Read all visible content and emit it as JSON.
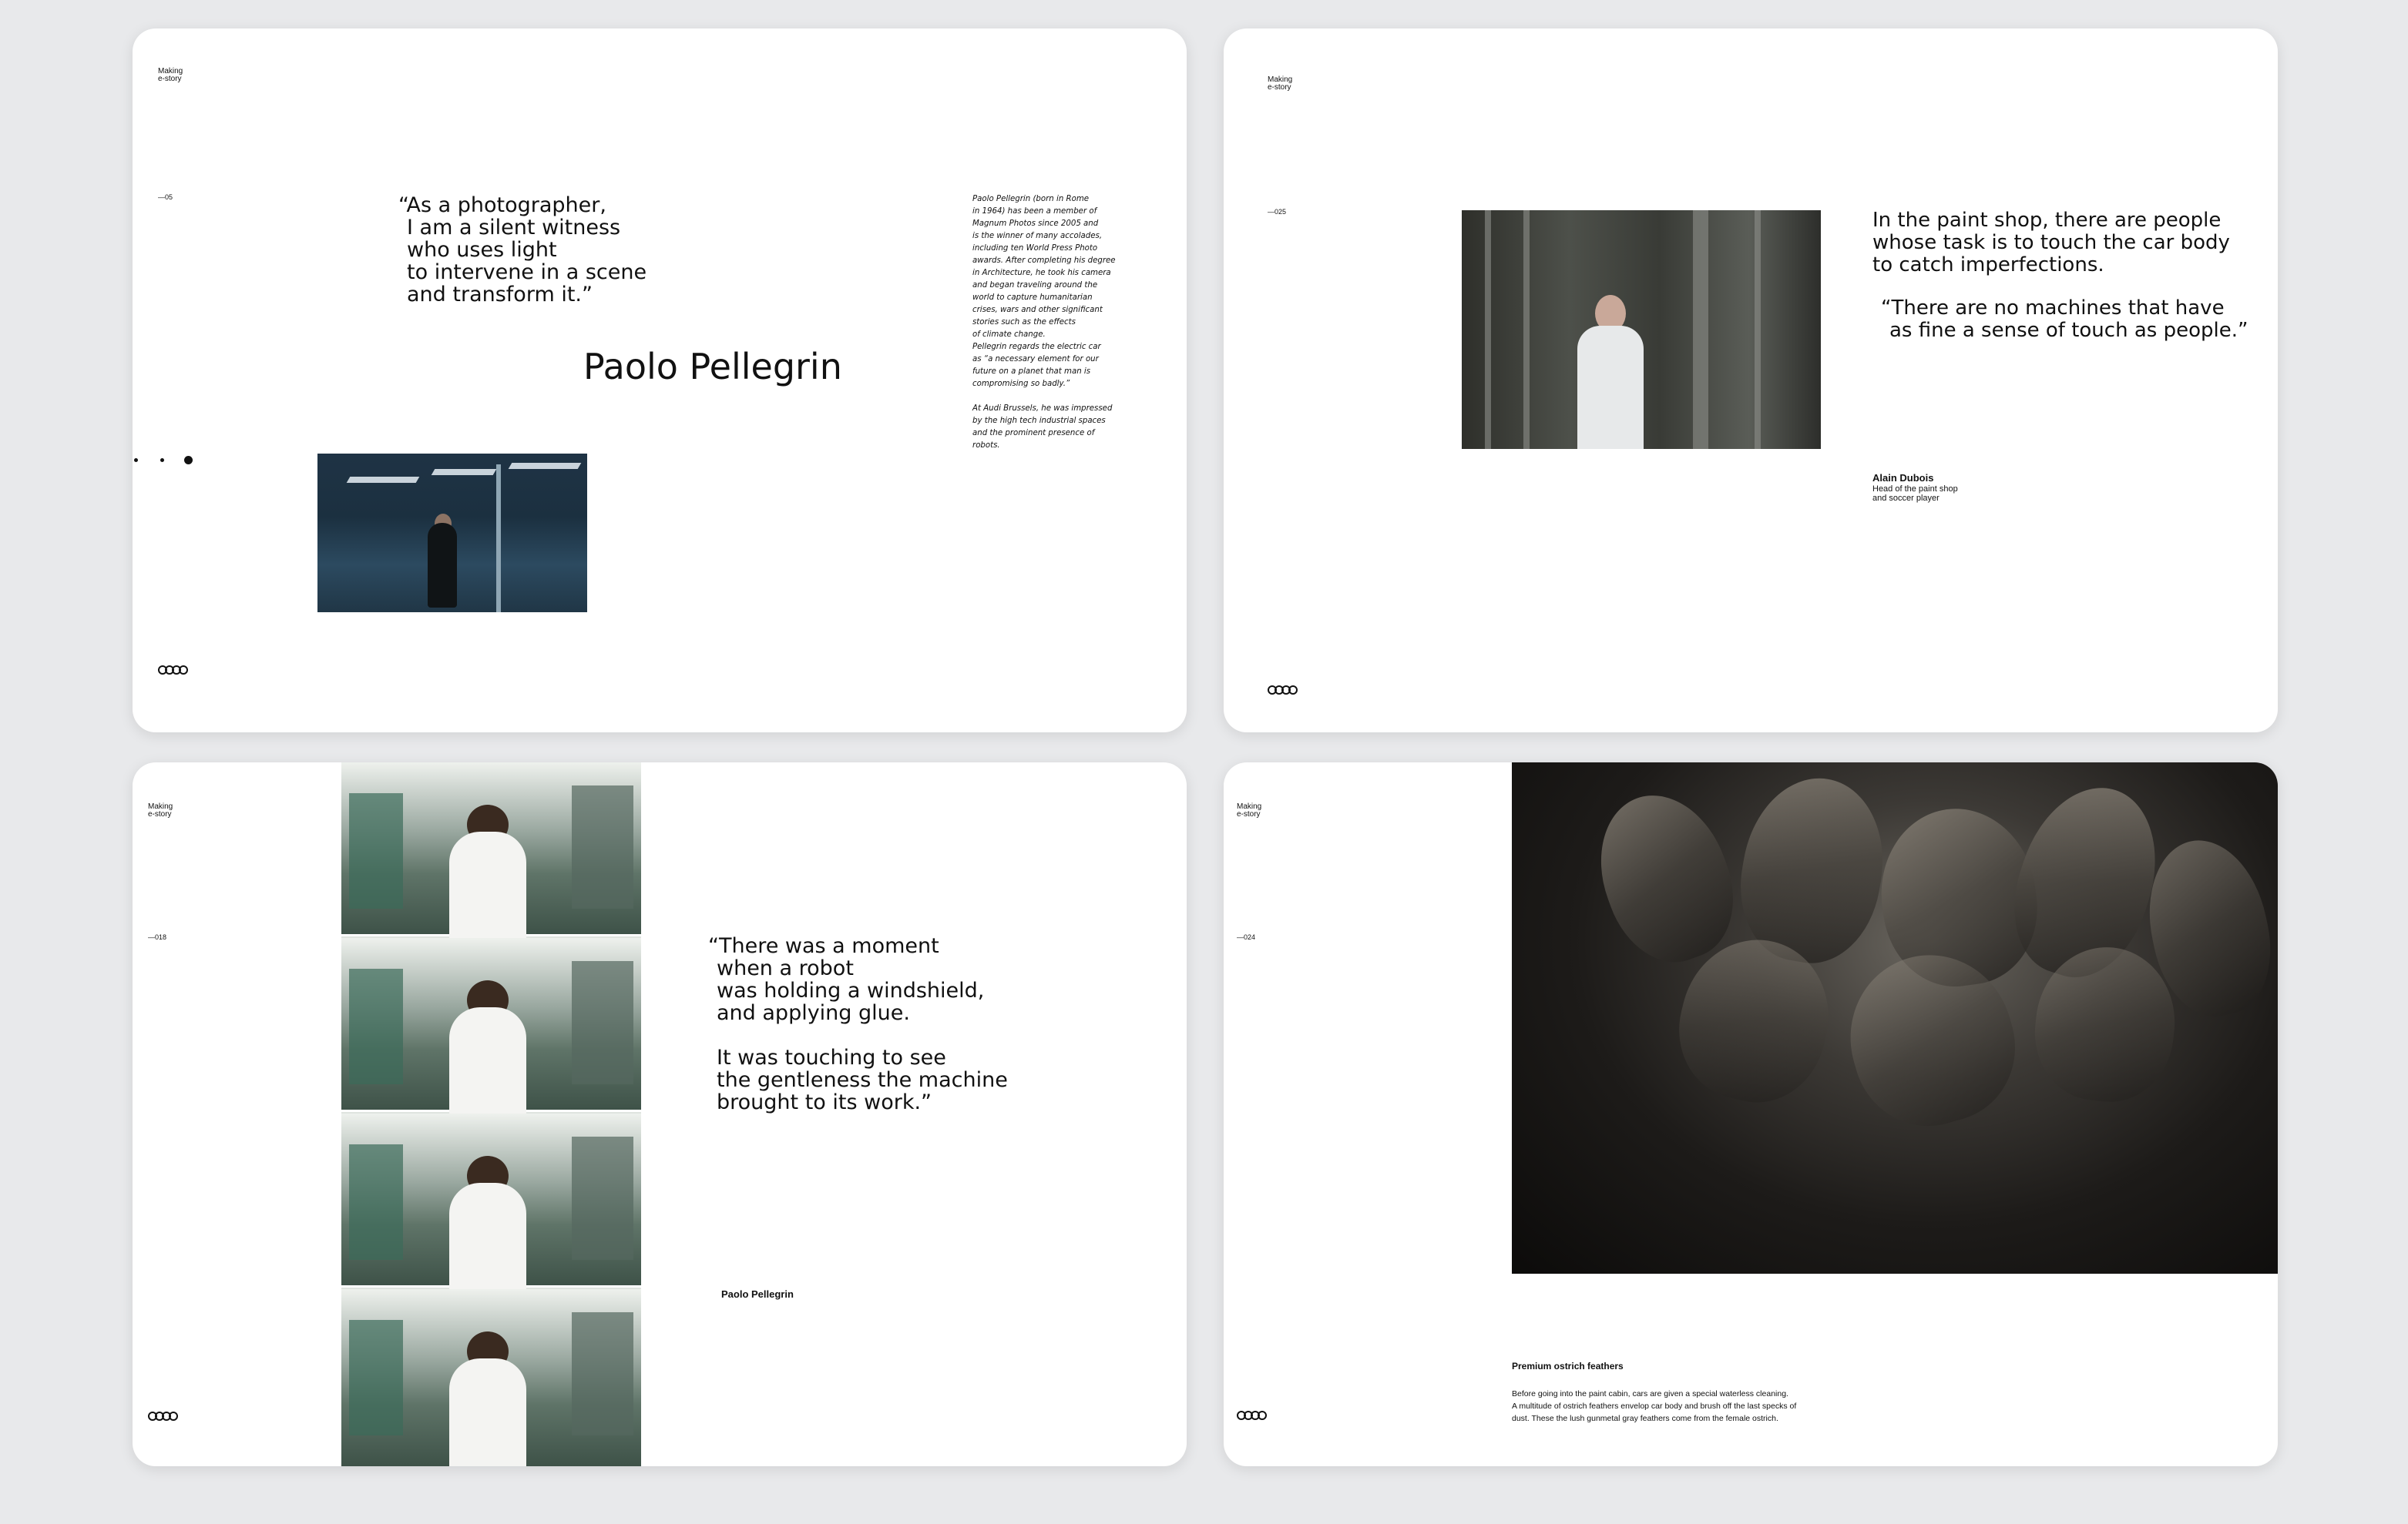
{
  "cards": [
    {
      "brand": "Making\ne-story",
      "page": "—05",
      "quote": "“As a photographer,\nI am a silent witness\nwho uses light\nto intervene in a scene\nand transform it.”",
      "name": "Paolo Pellegrin",
      "bio": "Paolo Pellegrin (born in Rome\nin 1964) has been a member of\nMagnum Photos since 2005 and\nis the winner of many accolades,\nincluding ten World Press Photo\nawards. After completing his degree\nin Architecture, he took his camera\nand began traveling around the\nworld to capture humanitarian\ncrises, wars and other significant\nstories such as the effects\nof climate change.\nPellegrin regards the electric car\nas “a necessary element for our\nfuture on a planet that man is\ncompromising so badly.”\n\nAt Audi Brussels, he was impressed\nby the high tech industrial spaces\nand the prominent presence of\nrobots."
    },
    {
      "brand": "Making\ne-story",
      "page": "—025",
      "text": "In the paint shop, there are people\nwhose task is to touch the car body\nto catch imperfections.",
      "quote": "“There are no machines that have\nas fine a sense of touch as people.”",
      "person": "Alain Dubois",
      "role": "Head of the paint shop\nand soccer player"
    },
    {
      "brand": "Making\ne-story",
      "page": "—018",
      "quote": "“There was a moment\nwhen a robot\nwas holding a windshield,\nand applying glue.\n\nIt was touching to see\nthe gentleness the machine\nbrought to its work.”",
      "person": "Paolo Pellegrin"
    },
    {
      "brand": "Making\ne-story",
      "page": "—024",
      "caption_title": "Premium ostrich feathers",
      "caption": "Before going into the paint cabin, cars are given a special waterless cleaning.\nA multitude of ostrich feathers envelop car body and brush off  the last specks of\ndust. These the lush gunmetal gray feathers come from the female ostrich."
    }
  ]
}
